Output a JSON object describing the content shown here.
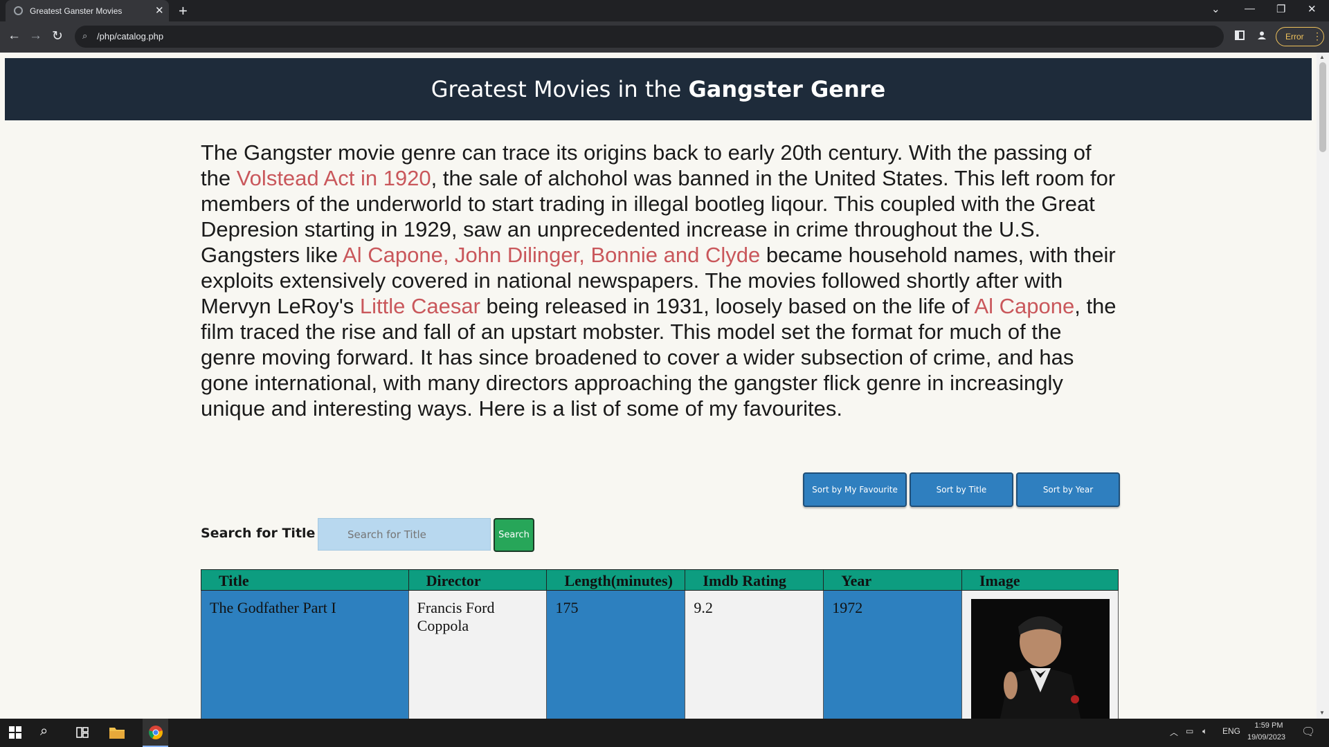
{
  "browser": {
    "tab_title": "Greatest Ganster Movies",
    "url": "/php/catalog.php",
    "error_label": "Error"
  },
  "page": {
    "header_prefix": "Greatest Movies in the ",
    "header_bold": "Gangster Genre",
    "intro": [
      {
        "t": "The Gangster movie genre can trace its origins back to early 20th century. With the passing of the ",
        "link": false
      },
      {
        "t": "Volstead Act in 1920",
        "link": true
      },
      {
        "t": ", the sale of alchohol was banned in the United States. This left room for members of the underworld to start trading in illegal bootleg liqour. This coupled with the Great Depresion starting in 1929, saw an unprecedented increase in crime throughout the U.S. Gangsters like ",
        "link": false
      },
      {
        "t": "Al Capone, John Dilinger, Bonnie and Clyde",
        "link": true
      },
      {
        "t": " became household names, with their exploits extensively covered in national newspapers. The movies followed shortly after with Mervyn LeRoy's ",
        "link": false
      },
      {
        "t": "Little Caesar",
        "link": true
      },
      {
        "t": " being released in 1931, loosely based on the life of ",
        "link": false
      },
      {
        "t": "Al Capone",
        "link": true
      },
      {
        "t": ", the film traced the rise and fall of an upstart mobster. This model set the format for much of the genre moving forward. It has since broadened to cover a wider subsection of crime, and has gone international, with many directors approaching the gangster flick genre in increasingly unique and interesting ways. Here is a list of some of my favourites.",
        "link": false
      }
    ],
    "sort_buttons": [
      "Sort by My Favourite",
      "Sort by Title",
      "Sort by Year"
    ],
    "search": {
      "label": "Search for Title",
      "placeholder": "Search for Title",
      "button": "Search"
    },
    "table": {
      "headers": [
        "Title",
        "Director",
        "Length(minutes)",
        "Imdb Rating",
        "Year",
        "Image"
      ],
      "rows": [
        {
          "title": "The Godfather Part I",
          "director": "Francis Ford Coppola",
          "length": "175",
          "rating": "9.2",
          "year": "1972"
        }
      ]
    }
  },
  "taskbar": {
    "lang": "ENG",
    "time": "1:59 PM",
    "date": "19/09/2023"
  },
  "colors": {
    "header_bg": "#1e2b3a",
    "link": "#c9575b",
    "button_blue": "#2f7fbf",
    "search_green": "#27a659",
    "table_header": "#0d9d80",
    "cell_blue": "#2d80bf"
  }
}
